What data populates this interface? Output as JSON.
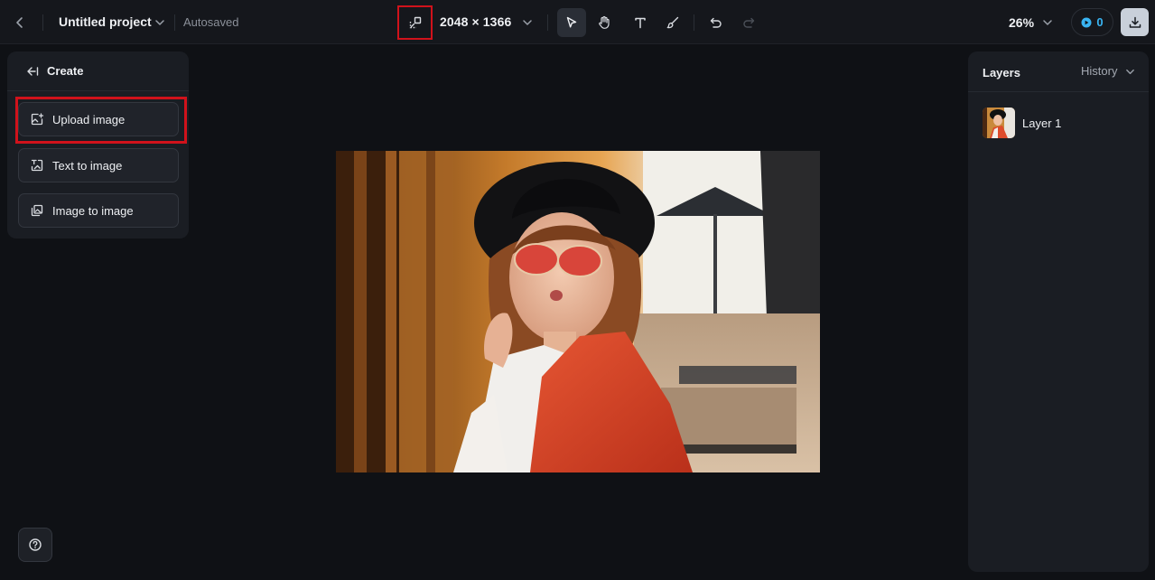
{
  "header": {
    "project_title": "Untitled project",
    "autosave_status": "Autosaved",
    "canvas_size": "2048 × 1366",
    "zoom": "26%",
    "credits": "0"
  },
  "create_panel": {
    "title": "Create",
    "items": [
      {
        "label": "Upload image"
      },
      {
        "label": "Text to image"
      },
      {
        "label": "Image to image"
      }
    ]
  },
  "layers_panel": {
    "title": "Layers",
    "history_tab": "History",
    "layers": [
      {
        "name": "Layer 1"
      }
    ]
  },
  "colors": {
    "background": "#0f1115",
    "panel": "#1a1d23",
    "highlight": "#d0121b",
    "accent": "#39b4f2"
  },
  "icons": {
    "back": "chevron-left-icon",
    "resize": "resize-canvas-icon",
    "select": "cursor-arrow-icon",
    "hand": "hand-pan-icon",
    "text": "text-tool-icon",
    "brush": "brush-icon",
    "undo": "undo-icon",
    "redo": "redo-icon",
    "download": "download-icon",
    "help": "help-circle-icon"
  }
}
